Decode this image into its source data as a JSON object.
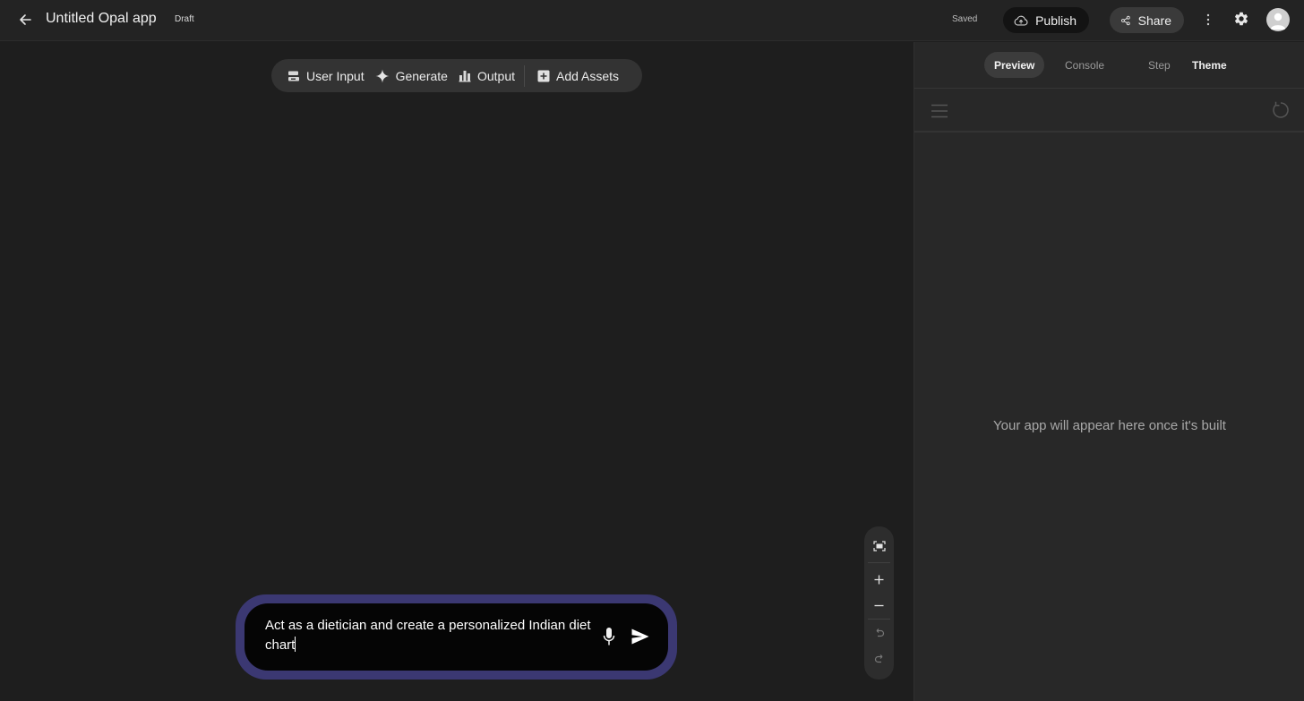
{
  "header": {
    "app_title": "Untitled Opal app",
    "draft_label": "Draft",
    "saved_label": "Saved",
    "publish_label": "Publish",
    "share_label": "Share",
    "icons": {
      "back": "arrow-back-icon",
      "publish": "cloud-upload-icon",
      "share": "share-icon",
      "more": "more-vert-icon",
      "settings": "gear-icon",
      "avatar": "user-avatar-icon"
    }
  },
  "toolbar": {
    "items": [
      {
        "label": "User Input",
        "icon": "user-input-icon"
      },
      {
        "label": "Generate",
        "icon": "sparkle-icon"
      },
      {
        "label": "Output",
        "icon": "output-icon"
      },
      {
        "label": "Add Assets",
        "icon": "add-box-icon"
      }
    ]
  },
  "prompt": {
    "text": "Act as a dietician and create a personalized Indian diet chart",
    "icons": {
      "mic": "microphone-icon",
      "send": "send-icon"
    }
  },
  "zoom_controls": {
    "icons": [
      "fit-view-icon",
      "zoom-in-icon",
      "zoom-out-icon",
      "undo-icon",
      "redo-icon"
    ]
  },
  "panel": {
    "tabs": [
      {
        "label": "Preview",
        "active": true
      },
      {
        "label": "Console",
        "active": false
      },
      {
        "label": "Step",
        "active": false
      },
      {
        "label": "Theme",
        "active": false
      }
    ],
    "empty_message": "Your app will appear here once it's built",
    "icons": {
      "menu": "hamburger-menu-icon",
      "refresh": "refresh-icon"
    }
  },
  "colors": {
    "background": "#1e1e1e",
    "topbar": "#232323",
    "panel": "#282828",
    "prompt_border": "#3b3872",
    "toolbar": "#333333"
  }
}
